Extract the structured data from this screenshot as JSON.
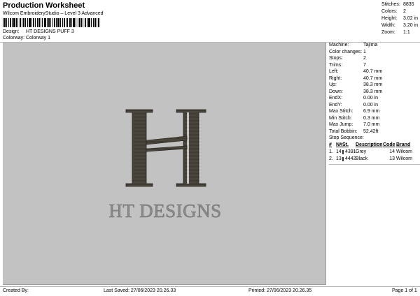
{
  "header": {
    "title": "Production Worksheet",
    "subtitle": "Wilcom EmbroideryStudio – Level 3 Advanced",
    "design_label": "Design:",
    "design_value": "HT DESIGNS PUFF 3",
    "colorway_label": "Colorway:",
    "colorway_value": "Colorway 1"
  },
  "summary": {
    "stitches_label": "Stitches:",
    "stitches": "8835",
    "colors_label": "Colors:",
    "colors": "2",
    "height_label": "Height:",
    "height": "3.02 in",
    "width_label": "Width:",
    "width": "3.20 in",
    "zoom_label": "Zoom:",
    "zoom": "1:1"
  },
  "design": {
    "monogram": "H",
    "text": "HT DESIGNS",
    "thread_color": "#3f3b32",
    "text_color": "#8a8a8a",
    "background": "#c2c2c2"
  },
  "details": {
    "machine_label": "Machine:",
    "machine": "Tajima",
    "color_changes_label": "Color changes:",
    "color_changes": "1",
    "stops_label": "Stops:",
    "stops": "2",
    "trims_label": "Trims:",
    "trims": "7",
    "left_label": "Left:",
    "left": "40.7 mm",
    "right_label": "Right:",
    "right": "40.7 mm",
    "up_label": "Up:",
    "up": "38.3 mm",
    "down_label": "Down:",
    "down": "38.3 mm",
    "endx_label": "EndX:",
    "endx": "0.00 in",
    "endy_label": "EndY:",
    "endy": "0.00 in",
    "max_stitch_label": "Max Stitch:",
    "max_stitch": "6.9 mm",
    "min_stitch_label": "Min Stitch:",
    "min_stitch": "0.3 mm",
    "max_jump_label": "Max Jump:",
    "max_jump": "7.0 mm",
    "total_bobbin_label": "Total Bobbin:",
    "total_bobbin": "52.42ft"
  },
  "stop_sequence": {
    "title": "Stop Sequence:",
    "headers": {
      "hash": "#",
      "n": "N#",
      "st": "St.",
      "description": "Description",
      "code": "Code",
      "brand": "Brand"
    },
    "rows": [
      {
        "hash": "1.",
        "n": "14",
        "st": "4391",
        "swatch": "#8d8d8d",
        "description": "Grey",
        "code": "14",
        "brand": "Wilcom"
      },
      {
        "hash": "2.",
        "n": "13",
        "st": "4442",
        "swatch": "#111111",
        "description": "Black",
        "code": "13",
        "brand": "Wilcom"
      }
    ]
  },
  "footer": {
    "created": "Created By:",
    "last_saved": "Last Saved: 27/06/2023 20.26.33",
    "printed": "Printed: 27/06/2023 20.26.35",
    "page": "Page 1 of 1"
  }
}
